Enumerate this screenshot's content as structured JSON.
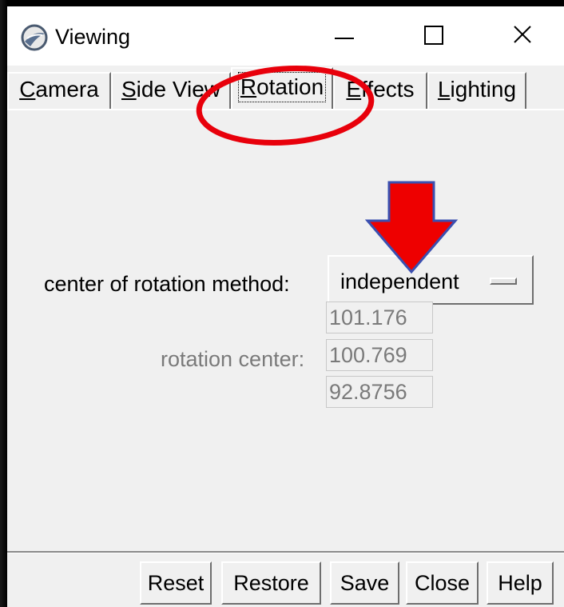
{
  "window": {
    "title": "Viewing",
    "controls": {
      "minimize": "minimize-icon",
      "maximize": "maximize-icon",
      "close": "close-icon"
    }
  },
  "tabs": [
    {
      "label": "Camera",
      "mnemonic": "C",
      "rest": "amera",
      "active": false
    },
    {
      "label": "Side View",
      "mnemonic": "S",
      "rest": "ide View",
      "active": false
    },
    {
      "label": "Rotation",
      "mnemonic": "R",
      "rest": "otation",
      "active": true
    },
    {
      "label": "Effects",
      "mnemonic": "E",
      "rest": "ffects",
      "active": false
    },
    {
      "label": "Lighting",
      "mnemonic": "L",
      "rest": "ighting",
      "active": false
    }
  ],
  "rotation": {
    "method_label": "center of rotation method:",
    "method_value": "independent",
    "center_label": "rotation center:",
    "center_values": [
      "101.176",
      "100.769",
      "92.8756"
    ]
  },
  "buttons": {
    "reset": "Reset",
    "restore": "Restore",
    "save": "Save",
    "close": "Close",
    "help": "Help"
  },
  "annotations": {
    "highlight_color": "#e8000b",
    "arrow_color": "#ee0000",
    "arrow_outline": "#3a4fb0"
  }
}
